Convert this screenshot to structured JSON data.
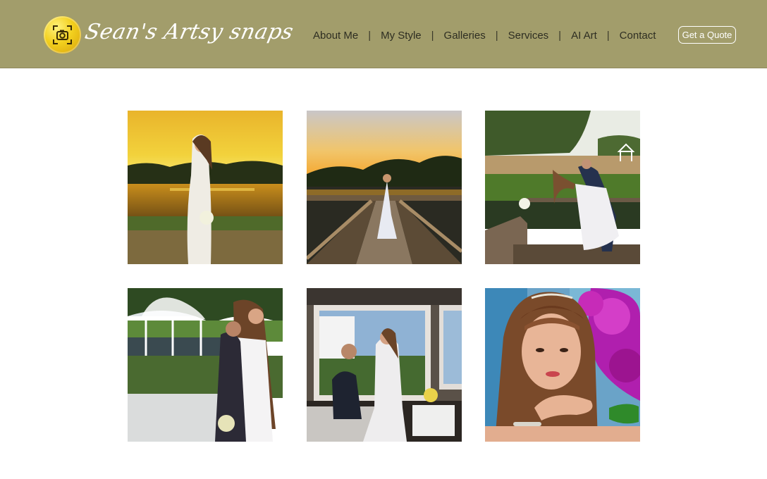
{
  "header": {
    "brand": "Sean's Artsy snaps",
    "logo_icon": "camera-focus-icon",
    "nav": [
      "About Me",
      "My Style",
      "Galleries",
      "Services",
      "AI Art",
      "Contact"
    ],
    "separator": "|",
    "quote_button": "Get a Quote"
  },
  "colors": {
    "header_bg": "#a29d6b",
    "logo_gold": "#f2cf1e",
    "nav_text": "#2e2e22",
    "page_bg": "#ffffff"
  },
  "gallery": {
    "photos": [
      "bride-sunset-lake-photo",
      "bride-on-dock-photo",
      "couple-dip-dock-photo",
      "couple-gazebo-photo",
      "couple-window-photo",
      "bride-portrait-orchids-photo"
    ]
  }
}
